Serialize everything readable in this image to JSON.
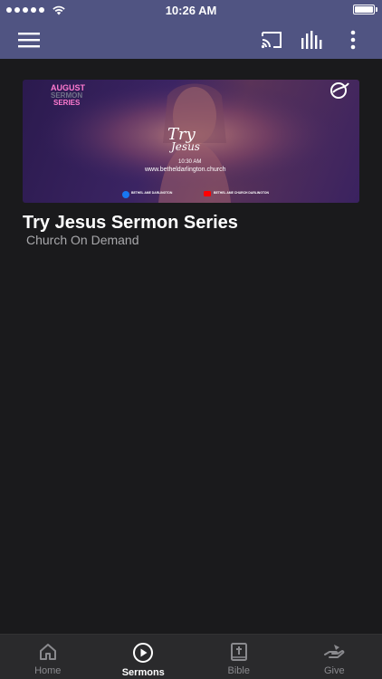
{
  "status_bar": {
    "time": "10:26 AM"
  },
  "sermon": {
    "title": "Try Jesus Sermon Series",
    "subtitle": "Church On Demand",
    "banner": {
      "badge_line1": "AUGUST",
      "badge_line2": "SERMON",
      "badge_line3": "SERIES",
      "script_line1": "Try",
      "script_line2": "Jesus",
      "time": "10:30 AM",
      "url": "www.betheldarlington.church",
      "facebook_label": "BETHEL AME DARLINGTON",
      "youtube_label": "BETHEL AME CHURCH DARLINGTON"
    }
  },
  "tabs": [
    {
      "label": "Home",
      "icon": "home-icon"
    },
    {
      "label": "Sermons",
      "icon": "play-circle-icon"
    },
    {
      "label": "Bible",
      "icon": "bible-icon"
    },
    {
      "label": "Give",
      "icon": "give-hand-icon"
    }
  ],
  "colors": {
    "header": "#505482",
    "background": "#1a1a1c",
    "tabbar": "#2a2a2c"
  }
}
